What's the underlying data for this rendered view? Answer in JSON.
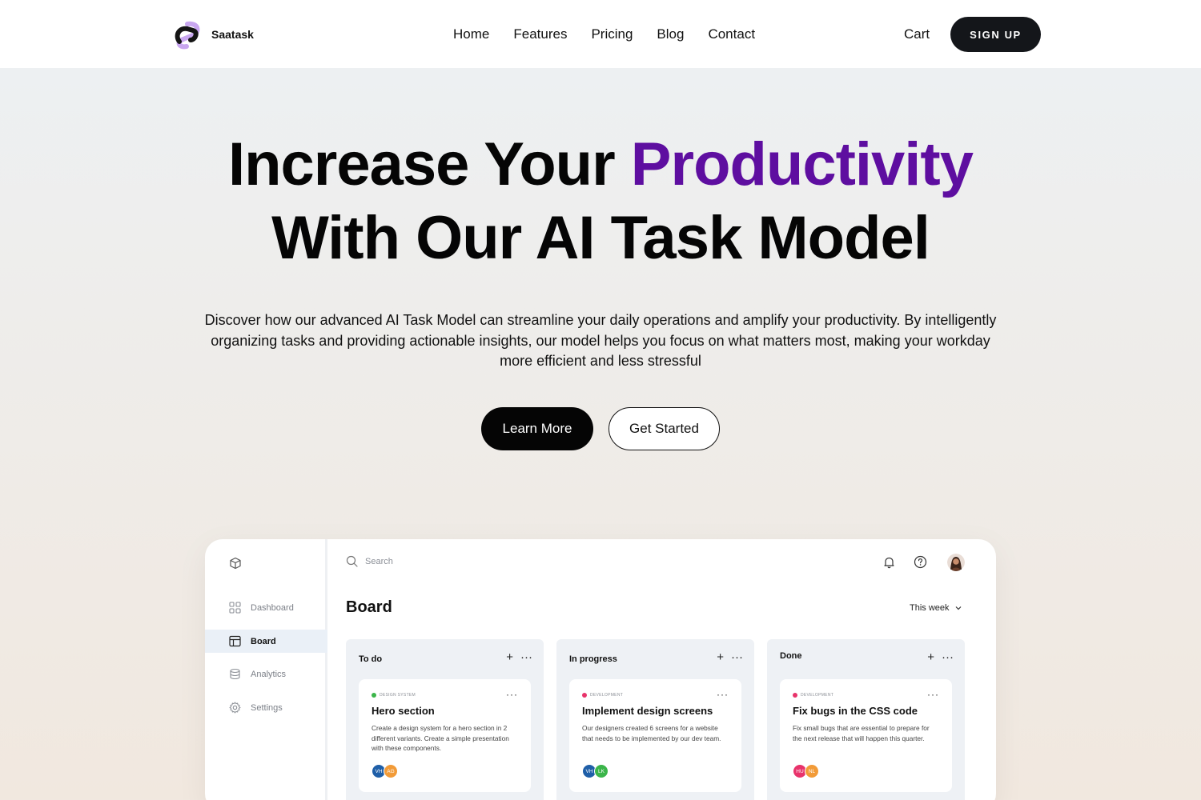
{
  "nav": {
    "brand": "Saatask",
    "links": [
      "Home",
      "Features",
      "Pricing",
      "Blog",
      "Contact"
    ],
    "cart": "Cart",
    "signup": "SIGN UP"
  },
  "hero": {
    "title_part1": "Increase Your ",
    "title_accent": "Productivity",
    "title_line2": "With Our AI Task Model",
    "subtitle": "Discover how our advanced AI Task Model can streamline your daily operations and amplify your productivity. By intelligently organizing tasks and providing actionable insights, our model helps you focus on what matters most, making your workday more efficient and less stressful",
    "primary_button": "Learn More",
    "secondary_button": "Get Started",
    "accent_color": "#5e0ea0"
  },
  "app": {
    "sidebar": [
      {
        "label": "Dashboard",
        "icon": "grid-icon"
      },
      {
        "label": "Board",
        "icon": "board-icon",
        "active": true
      },
      {
        "label": "Analytics",
        "icon": "database-icon"
      },
      {
        "label": "Settings",
        "icon": "gear-icon"
      }
    ],
    "search_placeholder": "Search",
    "board_title": "Board",
    "period": "This week",
    "columns": [
      {
        "title": "To do",
        "card": {
          "tag": "DESIGN SYSTEM",
          "tag_color": "#3bb54a",
          "title": "Hero section",
          "description": "Create a design system for a hero section in 2 different variants. Create a simple presentation with these components.",
          "assignees": [
            {
              "initials": "VH",
              "color": "#1f5fa8"
            },
            {
              "initials": "AG",
              "color": "#f29b38"
            }
          ]
        }
      },
      {
        "title": "In progress",
        "card": {
          "tag": "DEVELOPMENT",
          "tag_color": "#e8336b",
          "title": "Implement design screens",
          "description": "Our designers created 6 screens for a website that needs to be implemented by our dev team.",
          "assignees": [
            {
              "initials": "VH",
              "color": "#1f5fa8"
            },
            {
              "initials": "LK",
              "color": "#3bb54a"
            }
          ]
        }
      },
      {
        "title": "Done",
        "card": {
          "tag": "DEVELOPMENT",
          "tag_color": "#e8336b",
          "title": "Fix bugs in the CSS code",
          "description": "Fix small bugs that are essential to prepare for the next release that will happen this quarter.",
          "assignees": [
            {
              "initials": "HU",
              "color": "#e8336b"
            },
            {
              "initials": "NL",
              "color": "#f29b38"
            }
          ]
        }
      }
    ]
  }
}
